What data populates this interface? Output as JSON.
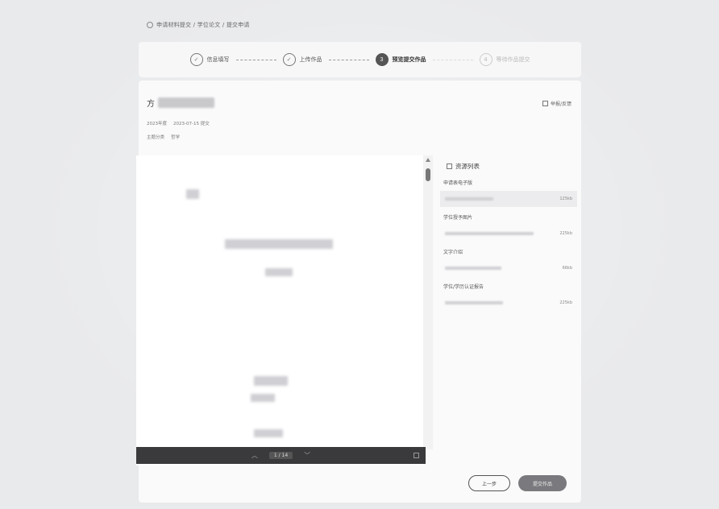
{
  "breadcrumb": "申请材料提交 / 学位论文 / 提交申请",
  "steps": [
    {
      "num": "✓",
      "label": "信息填写",
      "state": "done"
    },
    {
      "num": "✓",
      "label": "上传作品",
      "state": "done"
    },
    {
      "num": "3",
      "label": "预览提交作品",
      "state": "active"
    },
    {
      "num": "4",
      "label": "等待作品提交",
      "state": "todo"
    }
  ],
  "work": {
    "title_prefix": "方",
    "report_link": "举报/反馈",
    "meta1_label": "2023年度",
    "meta1_value": "2023-07-15 提交",
    "meta2_label": "主题分类",
    "meta2_value": "哲学"
  },
  "viewer": {
    "page": "1",
    "total": "14"
  },
  "file_list": {
    "header": "资源列表",
    "sections": [
      {
        "label": "申请表电子版",
        "files": [
          {
            "size": "125kb",
            "selected": true
          }
        ]
      },
      {
        "label": "学位授予图片",
        "files": [
          {
            "size": "225kb",
            "selected": false
          }
        ]
      },
      {
        "label": "文字介绍",
        "files": [
          {
            "size": "66kb",
            "selected": false
          }
        ]
      },
      {
        "label": "学位/学历认证报告",
        "files": [
          {
            "size": "225kb",
            "selected": false
          }
        ]
      }
    ]
  },
  "buttons": {
    "prev": "上一步",
    "submit": "提交作品"
  }
}
